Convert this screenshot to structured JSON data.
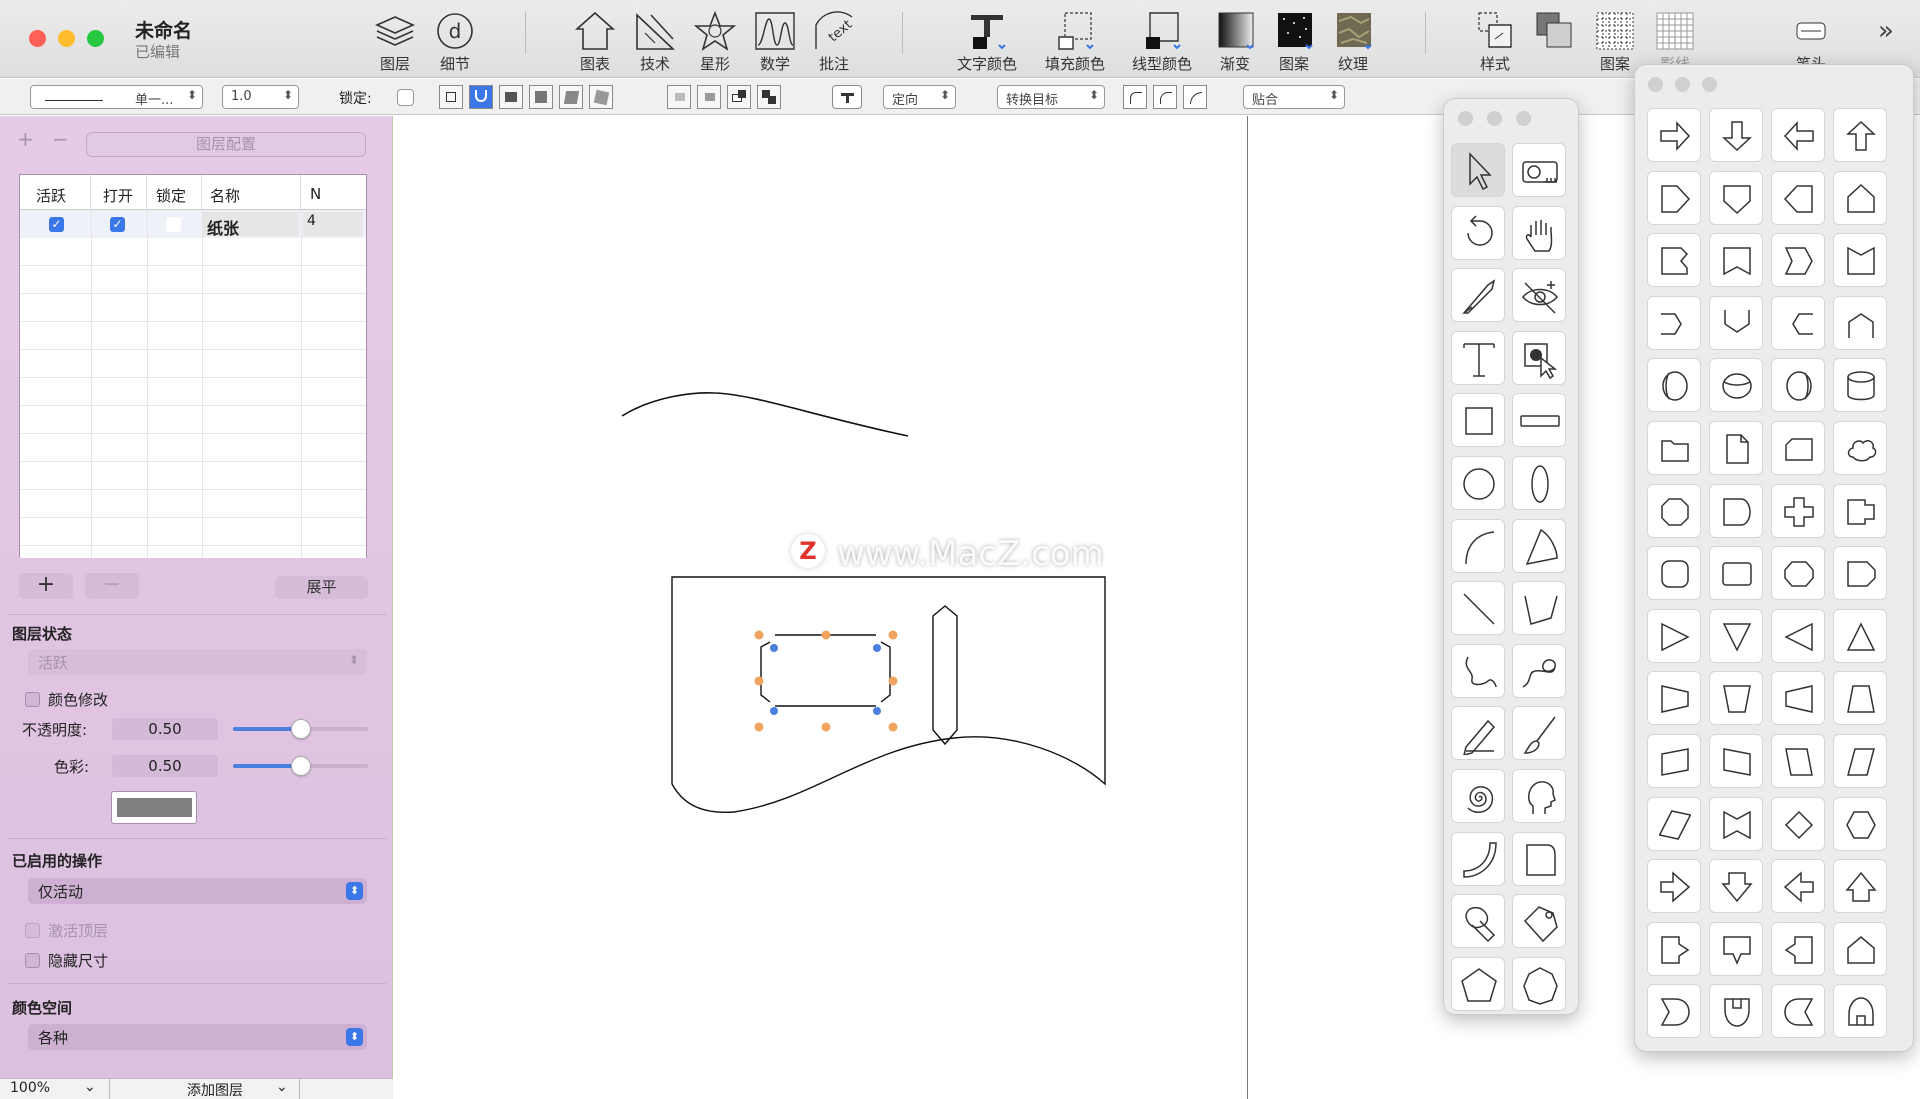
{
  "window": {
    "title": "未命名",
    "subtitle": "已编辑"
  },
  "toolbar": {
    "groups": [
      {
        "label": "图层",
        "icon": "layers-icon"
      },
      {
        "label": "细节",
        "icon": "detail-icon"
      },
      {
        "label": "图表",
        "icon": "house-chart-icon"
      },
      {
        "label": "技术",
        "icon": "technical-icon"
      },
      {
        "label": "星形",
        "icon": "star-icon"
      },
      {
        "label": "数学",
        "icon": "math-wave-icon"
      },
      {
        "label": "批注",
        "icon": "annotation-text-icon"
      },
      {
        "label": "文字颜色",
        "icon": "text-color-icon"
      },
      {
        "label": "填充颜色",
        "icon": "fill-color-icon"
      },
      {
        "label": "线型颜色",
        "icon": "line-color-icon"
      },
      {
        "label": "渐变",
        "icon": "gradient-icon"
      },
      {
        "label": "图案",
        "icon": "pattern-icon"
      },
      {
        "label": "纹理",
        "icon": "texture-icon"
      },
      {
        "label": "样式",
        "icon": "style-icon"
      },
      {
        "label": "",
        "icon": "arrange-icon"
      },
      {
        "label": "图案",
        "icon": "grid-pattern-icon"
      },
      {
        "label": "影线",
        "icon": "hatch-icon"
      },
      {
        "label": "笔头",
        "icon": "pen-tip-icon"
      }
    ],
    "overflow_icon": "chevron-double-right-icon"
  },
  "optionbar": {
    "line_style": "单一...",
    "line_width": "1.0",
    "lock_label": "锁定:",
    "orient": "定向",
    "convert": "转换目标",
    "snap": "贴合"
  },
  "sidebar": {
    "layer_config": "图层配置",
    "add": "+",
    "remove": "−",
    "table": {
      "headers": [
        "活跃",
        "打开",
        "锁定",
        "名称",
        "N"
      ],
      "rows": [
        {
          "active": true,
          "open": true,
          "locked": false,
          "name": "纸张",
          "n": "4"
        }
      ]
    },
    "flatten": "展平",
    "layer_state_title": "图层状态",
    "layer_state_value": "活跃",
    "color_modify": "颜色修改",
    "opacity_label": "不透明度:",
    "opacity_value": "0.50",
    "opacity_level": 0.5,
    "hue_label": "色彩:",
    "hue_value": "0.50",
    "hue_level": 0.5,
    "swatch_color": "#808080",
    "ops_title": "已启用的操作",
    "ops_value": "仅活动",
    "activate_top": "激活顶层",
    "hide_dims": "隐藏尺寸",
    "colorspace_title": "颜色空间",
    "colorspace_value": "各种"
  },
  "status": {
    "zoom": "100%",
    "add_layer": "添加图层"
  },
  "watermark": "www.MacZ.com",
  "colors": {
    "accent": "#3b77e8",
    "handle_orange": "#f0a460",
    "handle_blue": "#4a7fe0",
    "sidebar_bg": "#e6cbe6",
    "close": "#fe5f57",
    "minimize": "#febc2e",
    "zoom": "#28c840"
  },
  "tools_palette": {
    "tools": [
      "arrow-select-icon",
      "camera-measure-icon",
      "rotate-icon",
      "hand-pan-icon",
      "knife-icon",
      "hide-eye-icon",
      "text-tool-icon",
      "zoom-select-icon",
      "rectangle-icon",
      "rounded-bar-icon",
      "circle-icon",
      "ellipse-icon",
      "arc-icon",
      "sector-icon",
      "line-icon",
      "polyline-icon",
      "freehand-curve-icon",
      "spiral-curve-icon",
      "pencil-icon",
      "brush-icon",
      "spiral-icon",
      "head-profile-icon",
      "quarter-curve-icon",
      "rounded-rect-icon",
      "fill-bucket-icon",
      "tag-bucket-icon",
      "pentagon-icon",
      "heptagon-icon"
    ]
  },
  "shapes_palette": {
    "shapes": [
      "arrow-right-icon",
      "arrow-down-icon",
      "arrow-left-icon",
      "arrow-up-icon",
      "pentagon-right-icon",
      "pentagon-down-icon",
      "pentagon-left-icon",
      "pentagon-up-icon",
      "notch-left-icon",
      "ribbon-down-icon",
      "notch-right-icon",
      "ribbon-up-icon",
      "connector-right-icon",
      "connector-down-icon",
      "connector-left-icon",
      "connector-up-icon",
      "cylinder-v-icon",
      "cylinder-h-icon",
      "cylinder-v2-icon",
      "database-icon",
      "folder-icon",
      "document-icon",
      "card-icon",
      "cloud-icon",
      "octagon-icon",
      "rounded-tab-icon",
      "cross-icon",
      "tab-right-icon",
      "rounded-square-icon",
      "rounded-rect-shape-icon",
      "octagon-wide-icon",
      "pentagon-tab-icon",
      "triangle-right-icon",
      "triangle-down-icon",
      "triangle-left-icon",
      "triangle-up-icon",
      "trapezoid-right-icon",
      "trapezoid-down-icon",
      "trapezoid-left-icon",
      "trapezoid-up-icon",
      "parallelogram-a-icon",
      "parallelogram-b-icon",
      "parallelogram-c-icon",
      "parallelogram-d-icon",
      "parallelogram-e-icon",
      "bowtie-icon",
      "diamond-icon",
      "hexagon-icon",
      "fat-arrow-right-icon",
      "fat-arrow-down-icon",
      "fat-arrow-left-icon",
      "fat-arrow-up-icon",
      "tag-right-icon",
      "callout-down-icon",
      "tag-left-icon",
      "house-icon",
      "round-arrow-right-icon",
      "round-arrow-down-icon",
      "round-arrow-left-icon",
      "round-arrow-up-icon"
    ]
  }
}
